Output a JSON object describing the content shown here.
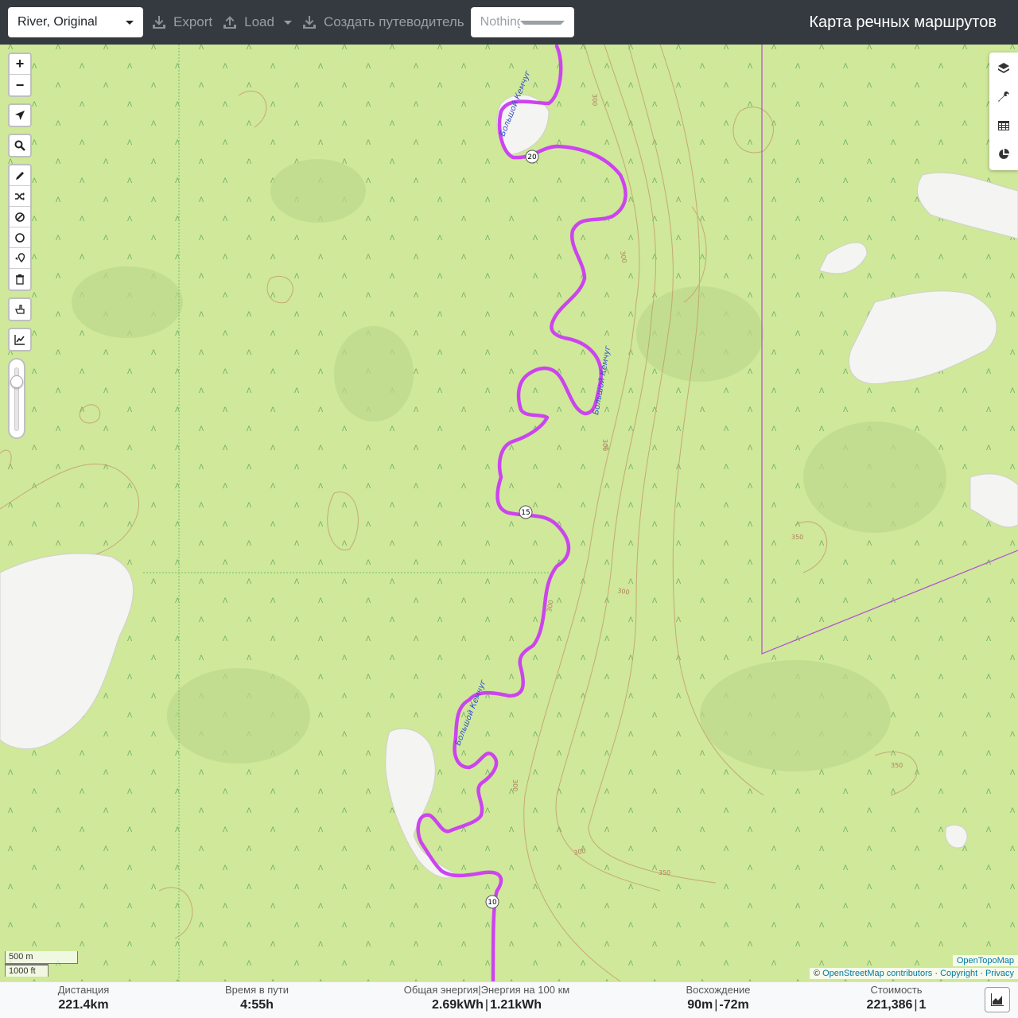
{
  "topbar": {
    "profile": "River, Original",
    "export_label": "Export",
    "load_label": "Load",
    "guide_label": "Создать путеводитель",
    "selection_placeholder": "Nothing sele",
    "title": "Карта речных маршрутов"
  },
  "map": {
    "river_labels": [
      "Большой Кемчуг",
      "Большой Кемчуг",
      "Большой Кемчуг"
    ],
    "km_markers": [
      "20",
      "15",
      "10"
    ],
    "contour_labels": [
      "300",
      "300",
      "300",
      "300",
      "300",
      "300",
      "300",
      "350",
      "350",
      "350"
    ],
    "route_color": "#cc44ee",
    "boundary_color": "#b04fd0",
    "land_color": "#cfe89a"
  },
  "controls": {
    "zoom_in": "+",
    "zoom_out": "−",
    "opacity_level": 0.85
  },
  "scale": {
    "metric": "500 m",
    "imperial": "1000 ft"
  },
  "attribution": {
    "tiles": "OpenTopoMap",
    "copy_symbol": "©",
    "osm": "OpenStreetMap contributors",
    "dot1": "·",
    "copyright": "Copyright",
    "dot2": "·",
    "privacy": "Privacy"
  },
  "stats": {
    "distance": {
      "label": "Дистанция",
      "value": "221.4",
      "unit": "km"
    },
    "time": {
      "label": "Время в пути",
      "value": "4:55",
      "unit": "h"
    },
    "energy": {
      "label": "Общая энергия|Энергия на 100 км",
      "value1": "2.69",
      "unit1": "kWh",
      "sep": "|",
      "value2": "1.21",
      "unit2": "kWh"
    },
    "ascent": {
      "label": "Восхождение",
      "value1": "90",
      "unit1": "m",
      "sep": "|",
      "value2": "-72",
      "unit2": "m"
    },
    "cost": {
      "label": "Стоимость",
      "value1": "221,386",
      "sep": "|",
      "value2": "1"
    }
  }
}
